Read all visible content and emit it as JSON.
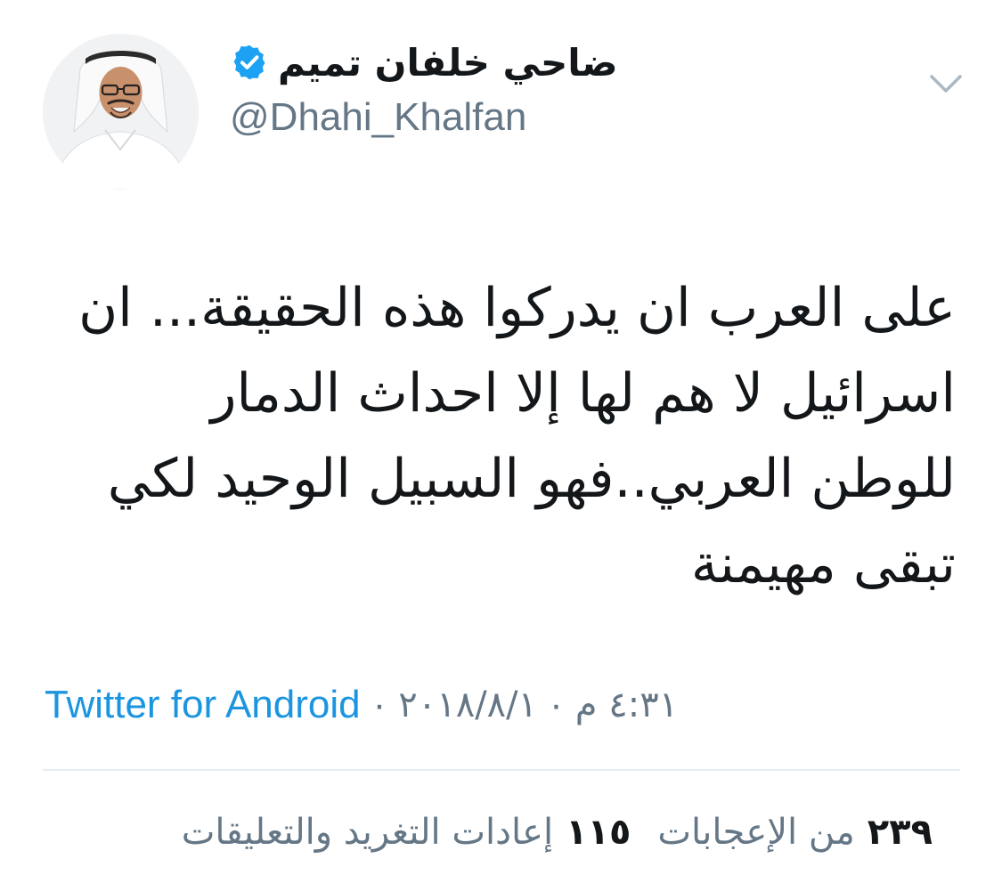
{
  "user": {
    "display_name": "ضاحي خلفان تميم",
    "handle": "@Dhahi_Khalfan",
    "verified": true,
    "avatar_icon": "profile-photo"
  },
  "tweet": {
    "lines": [
      "على العرب ان يدركوا هذه الحقيقة... ان",
      "اسرائيل لا هم لها إلا احداث الدمار",
      "للوطن العربي..فهو السبيل الوحيد لكي",
      "تبقى مهيمنة"
    ]
  },
  "meta": {
    "time": "٤:٣١ م",
    "date": "٢٠١٨/٨/١",
    "separator": "·",
    "source": "Twitter for Android"
  },
  "stats": {
    "likes_count": "٢٣٩",
    "likes_label": "من الإعجابات",
    "retweets_count": "١١٥",
    "retweets_label": "إعادات التغريد والتعليقات"
  },
  "colors": {
    "link": "#1b95e0",
    "secondary_text": "#657786",
    "primary_text": "#14171a",
    "verified_badge": "#1da1f2",
    "divider": "#e6ecf0"
  }
}
